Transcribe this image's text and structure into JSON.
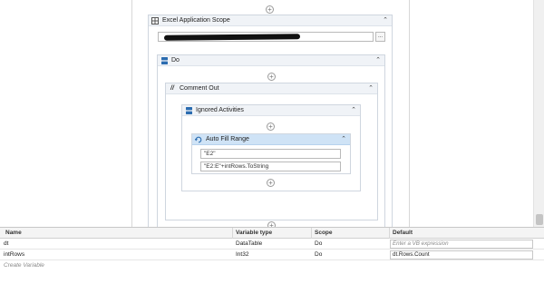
{
  "workflow": {
    "excel_scope": {
      "title": "Excel Application Scope",
      "path_value": "",
      "browse_label": "..."
    },
    "do_block": {
      "title": "Do"
    },
    "comment_out": {
      "title": "Comment Out"
    },
    "ignored": {
      "title": "Ignored Activities"
    },
    "autofill": {
      "title": "Auto Fill Range",
      "start_range": "\"E2\"",
      "end_range": "\"E2:E\"+intRows.ToString"
    }
  },
  "variables": {
    "headers": {
      "name": "Name",
      "type": "Variable type",
      "scope": "Scope",
      "default": "Default"
    },
    "rows": [
      {
        "name": "dt",
        "type": "DataTable",
        "scope": "Do",
        "default": "",
        "placeholder": "Enter a VB expression"
      },
      {
        "name": "intRows",
        "type": "Int32",
        "scope": "Do",
        "default": "dt.Rows.Count",
        "placeholder": ""
      }
    ],
    "create_label": "Create Variable"
  },
  "icons": {
    "add": "plus-circle-icon",
    "collapse": "double-chevron-up-icon",
    "sequence": "sequence-icon",
    "comment": "comment-out-icon",
    "autofill": "autofill-icon"
  },
  "colors": {
    "selected_header": "#cfe3f6",
    "header": "#f0f3f7",
    "border": "#cfd6df"
  }
}
